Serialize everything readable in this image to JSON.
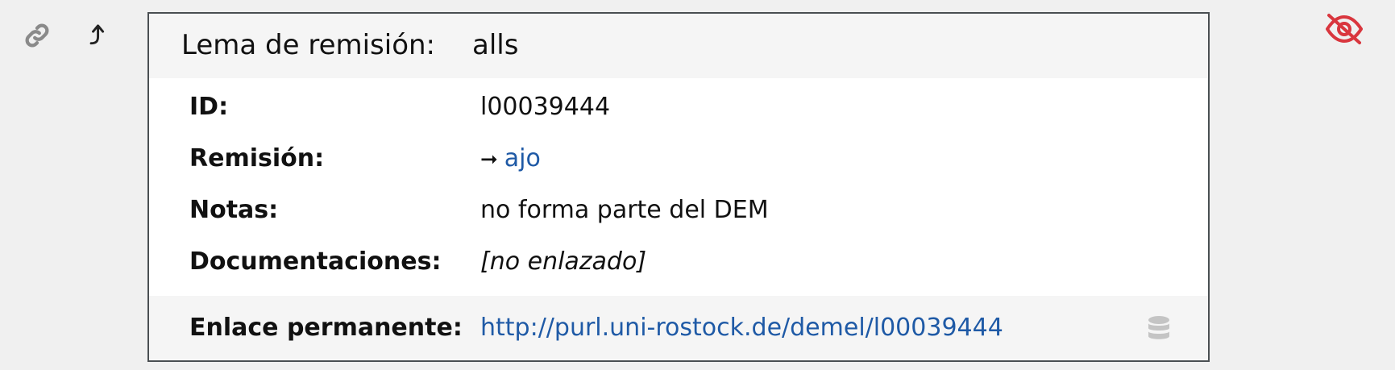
{
  "icons": {
    "link": "link-icon",
    "return": "return-arrow-icon",
    "hide": "eye-slash-icon",
    "database": "database-icon"
  },
  "colors": {
    "link": "#1f5aa6",
    "hide_icon": "#d9363e",
    "border": "#4a4f52"
  },
  "header": {
    "label": "Lema de remisión:",
    "value": "alls"
  },
  "rows": {
    "id": {
      "label": "ID:",
      "value": "l00039444"
    },
    "remision": {
      "label": "Remisión:",
      "arrow": "➞",
      "value": "ajo"
    },
    "notas": {
      "label": "Notas:",
      "value": "no forma parte del DEM"
    },
    "documentaciones": {
      "label": "Documentaciones:",
      "value": "[no enlazado]"
    }
  },
  "footer": {
    "label": "Enlace permanente:",
    "url": "http://purl.uni-rostock.de/demel/l00039444"
  }
}
